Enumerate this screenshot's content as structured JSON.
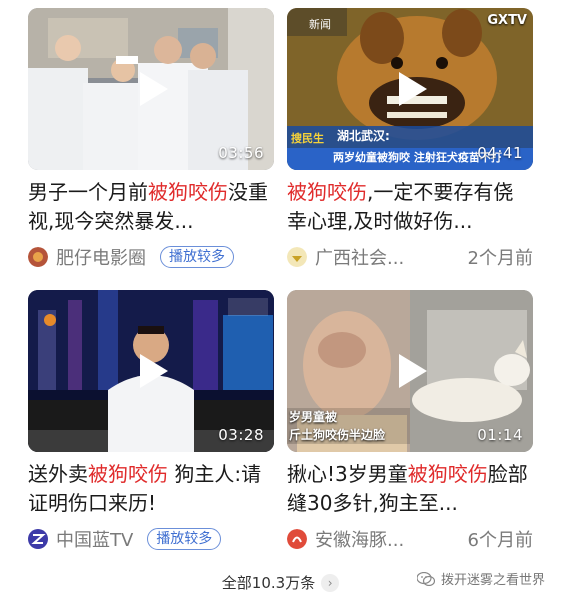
{
  "videos": [
    {
      "duration": "03:56",
      "title_hl": "",
      "title_pre": "男子一个月前",
      "title_hl2": "被狗咬伤",
      "title_post": "没重视,现今突然暴发...",
      "source": "肥仔电影圈",
      "badge": "播放较多",
      "time": "",
      "thumb_icon": "hospital-scene"
    },
    {
      "duration": "04:41",
      "title_pre": "",
      "title_hl2": "被狗咬伤",
      "title_post": ",一定不要存有侥幸心理,及时做好伤...",
      "source": "广西社会...",
      "badge": "",
      "time": "2个月前",
      "thumb_icon": "dog-news",
      "overlay_1": "湖北武汉:",
      "overlay_2": "两岁幼童被狗咬 注射狂犬疫苗不打",
      "channel_tag": "搜民生",
      "logo_text": "GXTV",
      "logo_sub": "新闻"
    },
    {
      "duration": "03:28",
      "title_pre": "送外卖",
      "title_hl2": "被狗咬伤",
      "title_post": " 狗主人:请证明伤口来历!",
      "source": "中国蓝TV",
      "badge": "播放较多",
      "time": "",
      "thumb_icon": "news-anchor"
    },
    {
      "duration": "01:14",
      "title_pre": "揪心!3岁男童",
      "title_hl2": "被狗咬伤",
      "title_post": "脸部缝30多针,狗主至...",
      "source": "安徽海豚...",
      "badge": "",
      "time": "6个月前",
      "thumb_icon": "child-and-dog",
      "overlay_1": "岁男童被",
      "overlay_2": "斤土狗咬伤半边脸"
    }
  ],
  "footer": {
    "more_label": "全部10.3万条",
    "more_chevron": "›"
  },
  "watermark": {
    "text": "拨开迷雾之看世界",
    "icon": "wechat-icon"
  },
  "colors": {
    "highlight": "#e02b2b",
    "badge": "#3f6fd1"
  }
}
